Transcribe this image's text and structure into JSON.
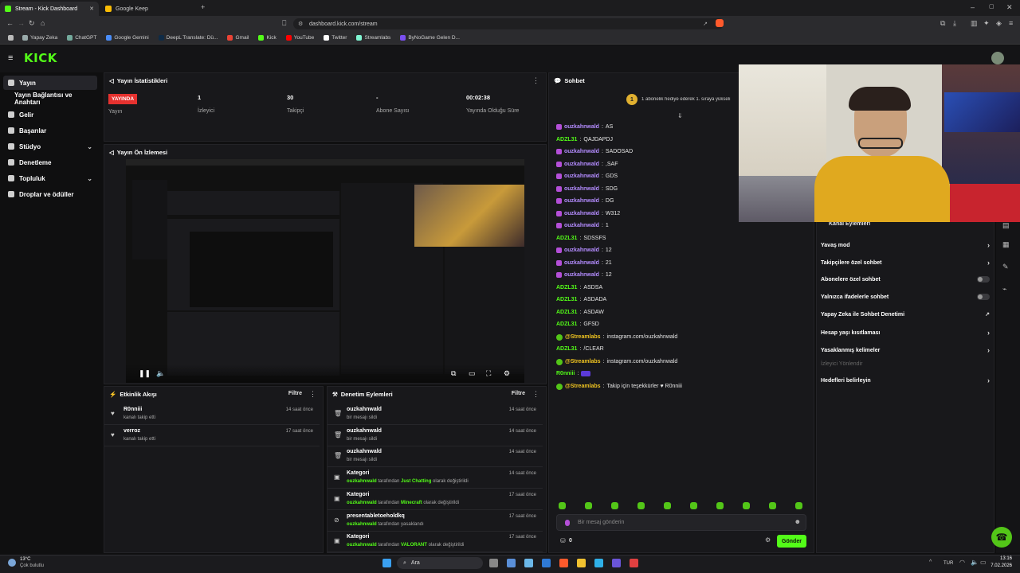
{
  "browser": {
    "tabs": [
      {
        "label": "Stream - Kick Dashboard"
      },
      {
        "label": "Google Keep"
      }
    ],
    "url": "dashboard.kick.com/stream",
    "bookmarks": [
      "Yapay Zeka",
      "ChatGPT",
      "Google Gemini",
      "DeepL Translate: Dü...",
      "Gmail",
      "Kick",
      "YouTube",
      "Twitter",
      "Streamlabs",
      "ByNoGame Gelen D..."
    ]
  },
  "app": {
    "logo": "KICK",
    "sidebar": [
      {
        "label": "Yayın",
        "icon": "broadcast-icon",
        "selected": true
      },
      {
        "label": "Yayın Bağlantısı ve Anahtarı",
        "icon": "",
        "selected": false
      },
      {
        "label": "Gelir",
        "icon": "wallet-icon",
        "selected": false
      },
      {
        "label": "Başarılar",
        "icon": "trophy-icon",
        "selected": false
      },
      {
        "label": "Stüdyo",
        "icon": "studio-icon",
        "selected": false
      },
      {
        "label": "Denetleme",
        "icon": "shield-icon",
        "selected": false
      },
      {
        "label": "Topluluk",
        "icon": "community-icon",
        "selected": false
      },
      {
        "label": "Droplar ve ödüller",
        "icon": "gift-icon",
        "selected": false
      }
    ]
  },
  "stats": {
    "title": "Yayın İstatistikleri",
    "live_badge": "YAYINDA",
    "status_label": "Yayın",
    "viewers": "1",
    "viewers_label": "İzleyici",
    "followers": "30",
    "followers_label": "Takipçi",
    "subs": "-",
    "subs_label": "Abone Sayısı",
    "uptime": "00:02:38",
    "uptime_label": "Yayında Olduğu Süre"
  },
  "preview": {
    "title": "Yayın Ön İzlemesi"
  },
  "activity": {
    "title": "Etkinlik Akışı",
    "filter": "Filtre",
    "items": [
      {
        "name": "R0nniii",
        "sub": "kanalı takip etti",
        "time": "14 saat önce"
      },
      {
        "name": "verroz",
        "sub": "kanalı takip etti",
        "time": "17 saat önce"
      }
    ]
  },
  "modlog": {
    "title": "Denetim Eylemleri",
    "filter": "Filtre",
    "items": [
      {
        "name": "ouzkahnwald",
        "pre": "",
        "mid": "bir mesajı sildi",
        "hl": "",
        "post": "",
        "time": "14 saat önce",
        "icon": "trash-icon"
      },
      {
        "name": "ouzkahnwald",
        "pre": "",
        "mid": "bir mesajı sildi",
        "hl": "",
        "post": "",
        "time": "14 saat önce",
        "icon": "trash-icon"
      },
      {
        "name": "ouzkahnwald",
        "pre": "",
        "mid": "bir mesajı sildi",
        "hl": "",
        "post": "",
        "time": "14 saat önce",
        "icon": "trash-icon"
      },
      {
        "name": "Kategori",
        "pre": "ouzkahnwald",
        "mid": " tarafından ",
        "hl": "Just Chatting",
        "post": " olarak değiştirildi",
        "time": "14 saat önce",
        "icon": "category-icon"
      },
      {
        "name": "Kategori",
        "pre": "ouzkahnwald",
        "mid": " tarafından ",
        "hl": "Minecraft",
        "post": " olarak değiştirildi",
        "time": "17 saat önce",
        "icon": "category-icon"
      },
      {
        "name": "presentabletoeholdkq",
        "pre": "ouzkahnwald",
        "mid": " tarafından yasaklandı",
        "hl": "",
        "post": "",
        "time": "17 saat önce",
        "icon": "ban-icon"
      },
      {
        "name": "Kategori",
        "pre": "ouzkahnwald",
        "mid": " tarafından ",
        "hl": "VALORANT",
        "post": " olarak değiştirildi",
        "time": "17 saat önce",
        "icon": "category-icon"
      }
    ]
  },
  "chat": {
    "title": "Sohbet",
    "pinned": "1 abonelik hediye ederek 1. sıraya yükseli",
    "messages": [
      {
        "user": "ouzkahnwald",
        "text": "AS",
        "color": "#b48cff",
        "badge": true
      },
      {
        "user": "ADZL31",
        "text": "QAJDAPDJ",
        "color": "#53fc18",
        "badge": false
      },
      {
        "user": "ouzkahnwald",
        "text": "SADOSAD",
        "color": "#b48cff",
        "badge": true
      },
      {
        "user": "ouzkahnwald",
        "text": ",SAF",
        "color": "#b48cff",
        "badge": true
      },
      {
        "user": "ouzkahnwald",
        "text": "GDS",
        "color": "#b48cff",
        "badge": true
      },
      {
        "user": "ouzkahnwald",
        "text": "SDG",
        "color": "#b48cff",
        "badge": true
      },
      {
        "user": "ouzkahnwald",
        "text": "DG",
        "color": "#b48cff",
        "badge": true
      },
      {
        "user": "ouzkahnwald",
        "text": "W312",
        "color": "#b48cff",
        "badge": true
      },
      {
        "user": "ouzkahnwald",
        "text": "1",
        "color": "#b48cff",
        "badge": true
      },
      {
        "user": "ADZL31",
        "text": "SDSSFS",
        "color": "#53fc18",
        "badge": false
      },
      {
        "user": "ouzkahnwald",
        "text": "12",
        "color": "#b48cff",
        "badge": true
      },
      {
        "user": "ouzkahnwald",
        "text": "21",
        "color": "#b48cff",
        "badge": true
      },
      {
        "user": "ouzkahnwald",
        "text": "12",
        "color": "#b48cff",
        "badge": true
      },
      {
        "user": "ADZL31",
        "text": "ASDSA",
        "color": "#53fc18",
        "badge": false
      },
      {
        "user": "ADZL31",
        "text": "ASDADA",
        "color": "#53fc18",
        "badge": false
      },
      {
        "user": "ADZL31",
        "text": "ASDAW",
        "color": "#53fc18",
        "badge": false
      },
      {
        "user": "ADZL31",
        "text": "GFSD",
        "color": "#53fc18",
        "badge": false
      },
      {
        "user": "@Streamlabs",
        "text": "instagram.com/ouzkahnwald",
        "color": "#f0c420",
        "badge": false
      },
      {
        "user": "ADZL31",
        "text": "/CLEAR",
        "color": "#53fc18",
        "badge": false
      },
      {
        "user": "@Streamlabs",
        "text": "instagram.com/ouzkahnwald",
        "color": "#f0c420",
        "badge": false
      },
      {
        "user": "R0nniii",
        "text": "",
        "color": "#53fc18",
        "badge": false
      },
      {
        "user": "@Streamlabs",
        "text": "Takip için teşekkürler ♥ R0nniii",
        "color": "#f0c420",
        "badge": false
      }
    ],
    "input_placeholder": "Bir mesaj gönderin",
    "points": "0",
    "send": "Gönder"
  },
  "channel_actions": {
    "title": "Kanal Eylemleri",
    "options": [
      {
        "label": "Yavaş mod",
        "type": "arrow"
      },
      {
        "label": "Takipçilere özel sohbet",
        "type": "arrow"
      },
      {
        "label": "Abonelere özel sohbet",
        "type": "toggle"
      },
      {
        "label": "Yalnızca ifadelerle sohbet",
        "type": "toggle"
      },
      {
        "label": "Yapay Zeka ile Sohbet Denetimi",
        "type": "ext"
      },
      {
        "label": "Hesap yaşı kısıtlaması",
        "type": "arrow"
      },
      {
        "label": "Yasaklanmış kelimeler",
        "type": "arrow"
      },
      {
        "label": "İzleyici Yönlendir",
        "type": "disabled"
      },
      {
        "label": "Hedefleri belirleyin",
        "type": "arrow"
      }
    ]
  },
  "taskbar": {
    "weather_temp": "13°C",
    "weather_text": "Çok bulutlu",
    "search": "Ara",
    "lang": "TUR",
    "time": "13:16",
    "date": "7.02.2026"
  }
}
